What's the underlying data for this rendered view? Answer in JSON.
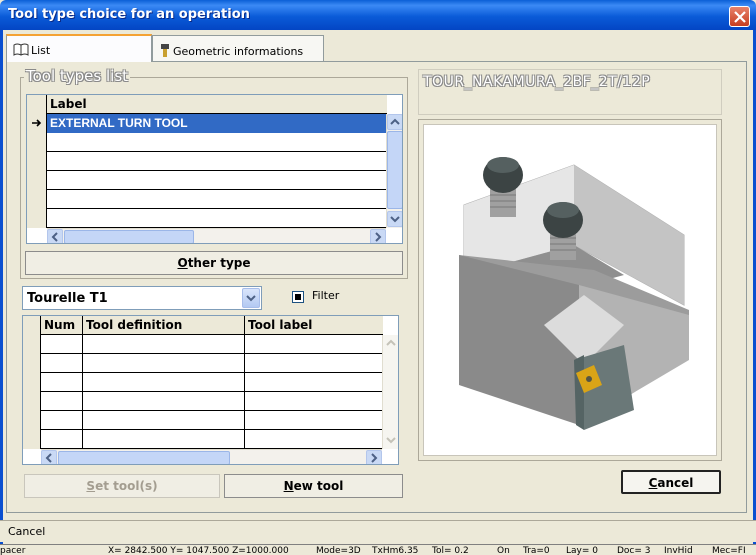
{
  "window": {
    "title": "Tool type choice for an operation"
  },
  "tabs": [
    {
      "label": "List",
      "icon": "book-icon",
      "active": true
    },
    {
      "label": "Geometric informations",
      "icon": "tool-icon",
      "active": false
    }
  ],
  "tool_types": {
    "title": "Tool types list",
    "column_header": "Label",
    "rows": [
      "EXTERNAL TURN TOOL",
      "",
      "",
      "",
      "",
      ""
    ],
    "selected_index": 0
  },
  "other_type_button": {
    "label_underlined": "O",
    "label_rest": "ther type"
  },
  "turret": {
    "selected": "Tourelle T1"
  },
  "filter": {
    "label": "Filter",
    "checked": true
  },
  "tools_table": {
    "columns": [
      "Num",
      "Tool definition",
      "Tool label"
    ],
    "rows": [
      [
        "",
        "",
        ""
      ],
      [
        "",
        "",
        ""
      ],
      [
        "",
        "",
        ""
      ],
      [
        "",
        "",
        ""
      ],
      [
        "",
        "",
        ""
      ],
      [
        "",
        "",
        ""
      ]
    ]
  },
  "set_tools_button": {
    "label_underlined": "S",
    "label_rest": "et tool(s)"
  },
  "new_tool_button": {
    "label_underlined": "N",
    "label_rest": "ew tool"
  },
  "cancel_button": {
    "label_underlined": "C",
    "label_rest": "ancel"
  },
  "tool_name": "TOUR_NAKAMURA_2BF_2T/12P",
  "status_bar": {
    "text": "Cancel"
  },
  "bottom_strip": {
    "left": "pacer",
    "coords": "X= 2842.500  Y= 1047.500  Z=1000.000",
    "mode": "Mode=3D",
    "txhm": "TxHm6.35",
    "tol": "Tol=  0.2",
    "on": "On",
    "tra": "Tra=0",
    "lay": "Lay=  0",
    "doc": "Doc=  3",
    "inv": "InvHid",
    "mec": "Mec=FI"
  },
  "colors": {
    "titlebar": "#0a5bd8",
    "selection": "#316ac5",
    "window_bg": "#ece9d8"
  }
}
